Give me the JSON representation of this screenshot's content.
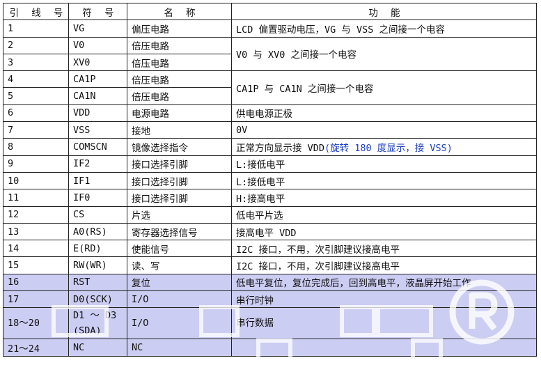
{
  "headers": {
    "pin": "引 线 号",
    "symbol": "符 号",
    "name": "名 称",
    "function": "功 能"
  },
  "rows": [
    {
      "pin": "1",
      "symbol": "VG",
      "name": "偏压电路",
      "function": "LCD 偏置驱动电压，VG 与 VSS 之间接一个电容"
    },
    {
      "pin": "2",
      "symbol": "V0",
      "name": "倍压电路",
      "function": "V0 与 XV0 之间接一个电容"
    },
    {
      "pin": "3",
      "symbol": "XV0",
      "name": "倍压电路"
    },
    {
      "pin": "4",
      "symbol": "CA1P",
      "name": "倍压电路",
      "function": "CA1P 与 CA1N 之间接一个电容"
    },
    {
      "pin": "5",
      "symbol": "CA1N",
      "name": "倍压电路"
    },
    {
      "pin": "6",
      "symbol": "VDD",
      "name": "电源电路",
      "function": "供电电源正极"
    },
    {
      "pin": "7",
      "symbol": "VSS",
      "name": "接地",
      "function": "0V"
    },
    {
      "pin": "8",
      "symbol": "COMSCN",
      "name": "镜像选择指令",
      "function": "正常方向显示接 VDD",
      "function_note": "(旋转 180 度显示，接 VSS)"
    },
    {
      "pin": "9",
      "symbol": "IF2",
      "name": "接口选择引脚",
      "function": "L:接低电平"
    },
    {
      "pin": "10",
      "symbol": "IF1",
      "name": "接口选择引脚",
      "function": "L:接低电平"
    },
    {
      "pin": "11",
      "symbol": "IF0",
      "name": "接口选择引脚",
      "function": "H:接高电平"
    },
    {
      "pin": "12",
      "symbol": "CS",
      "name": "片选",
      "function": "低电平片选"
    },
    {
      "pin": "13",
      "symbol": "A0(RS)",
      "name": "寄存器选择信号",
      "function": "接高电平 VDD"
    },
    {
      "pin": "14",
      "symbol": "E(RD)",
      "name": "使能信号",
      "function": "I2C 接口，不用，次引脚建议接高电平"
    },
    {
      "pin": "15",
      "symbol": "RW(WR)",
      "name": "读、写",
      "function": "I2C 接口，不用，次引脚建议接高电平"
    },
    {
      "pin": "16",
      "symbol": "RST",
      "name": "复位",
      "function": "低电平复位，复位完成后，回到高电平，液晶屏开始工作"
    },
    {
      "pin": "17",
      "symbol": "D0(SCK)",
      "name": "I/O",
      "function": "串行时钟"
    },
    {
      "pin": "18～20",
      "symbol": "D1 ～ D3",
      "symbol_line2": "(SDA)",
      "name": "I/O",
      "function": "串行数据"
    },
    {
      "pin": "21～24",
      "symbol": "NC",
      "name": "NC"
    }
  ],
  "colors": {
    "highlight": "#cccdf2",
    "note_blue": "#1a3cc0",
    "border": "#222222"
  },
  "watermark": {
    "icon": "registered-mark-icon"
  }
}
